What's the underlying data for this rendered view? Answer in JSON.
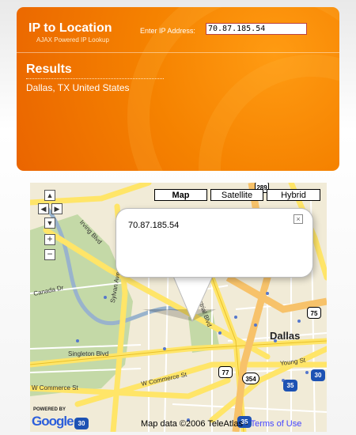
{
  "app": {
    "title": "IP to Location",
    "subtitle": "AJAX Powered IP Lookup"
  },
  "lookup": {
    "label": "Enter IP Address:",
    "value": "70.87.185.54"
  },
  "results": {
    "heading": "Results",
    "location": "Dallas, TX United States"
  },
  "map": {
    "types": [
      "Map",
      "Satellite",
      "Hybrid"
    ],
    "active_type": "Map",
    "pan_controls": [
      "up-arrow-icon",
      "left-arrow-icon",
      "right-arrow-icon",
      "down-arrow-icon"
    ],
    "zoom_in": "+",
    "zoom_out": "−",
    "info_window": {
      "text": "70.87.185.54",
      "close": "×"
    },
    "labels": {
      "city": "Dallas",
      "irving_blvd": "Irving Blvd",
      "sylvan_ave": "Sylvan Ave",
      "canada_dr": "Canada Dr",
      "singleton_blvd": "Singleton Blvd",
      "commerce_st": "W Commerce St",
      "commerce_st2": "W Commerce St",
      "young_st": "Young St",
      "industrial_blvd": "N Industrial Blvd"
    },
    "shields": [
      "289",
      "75",
      "77",
      "354",
      "35",
      "30",
      "30",
      "35"
    ],
    "powered_by": "POWERED BY",
    "brand": "Google",
    "copyright": "Map data ©2006 TeleAtlas -",
    "terms": "Terms of Use"
  },
  "colors": {
    "panel_orange": "#f58200",
    "road_yellow": "#ffe568",
    "park_green": "#c4d9a7",
    "river_blue": "#99b3cc",
    "link_blue": "#4444ff"
  }
}
